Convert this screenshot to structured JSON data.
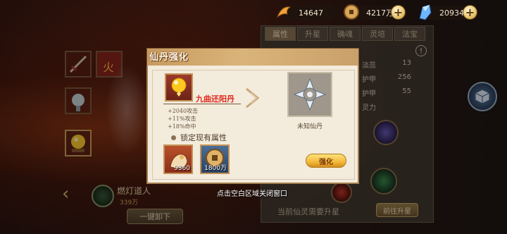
{
  "currencies": [
    {
      "icon": "fox-spirit-icon",
      "value": "14647"
    },
    {
      "icon": "copper-coin-icon",
      "value": "4217万",
      "has_plus": true
    },
    {
      "icon": "blue-crystal-icon",
      "value": "20934",
      "has_plus": true
    }
  ],
  "right_panel": {
    "tabs": [
      "属性",
      "升星",
      "确魂",
      "灵培",
      "法宝"
    ],
    "active_tab": 0,
    "stat_rows": [
      {
        "label": "淡蕊",
        "value": "13"
      },
      {
        "label": "护甲",
        "value": "256"
      },
      {
        "label": "护甲",
        "value": "55"
      },
      {
        "label": "灵力",
        "value": ""
      }
    ],
    "info_symbol": "!",
    "footer_text": "当前仙灵需要升星",
    "upgrade_button": "前往升星"
  },
  "left": {
    "slot_label": "火",
    "character_name": "燃灯道人",
    "character_sub": "339万",
    "unload_button": "一键卸下"
  },
  "dialog": {
    "title": "仙丹强化",
    "elixir_name": "九曲还阳丹",
    "bonuses": [
      "+2040攻击",
      "+11%攻击",
      "+18%命中"
    ],
    "unknown_label": "未知仙丹",
    "lock_label": "锁定现有属性",
    "materials": [
      {
        "icon": "lucky-cat-icon",
        "count": "9360"
      },
      {
        "icon": "copper-coin-icon",
        "count": "1800万"
      }
    ],
    "strengthen_button": "强化"
  },
  "close_hint": "点击空白区域关闭窗口",
  "colors": {
    "accent_red": "#e2281f",
    "dialog_bg": "#f3ebdc",
    "button_gold": "#f3b83a"
  }
}
